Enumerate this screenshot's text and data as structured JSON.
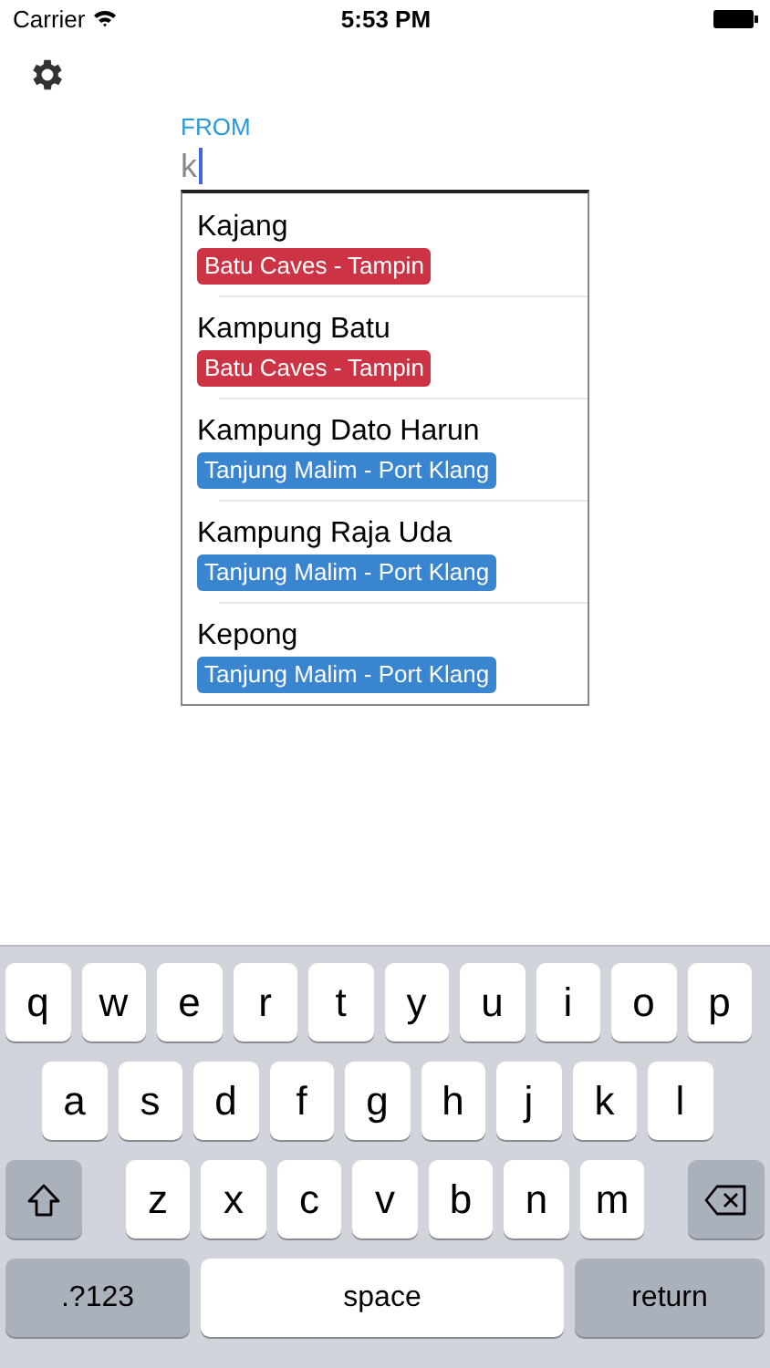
{
  "status_bar": {
    "carrier": "Carrier",
    "time": "5:53 PM"
  },
  "field": {
    "label": "FROM",
    "value": "k"
  },
  "suggestions": [
    {
      "name": "Kajang",
      "route": "Batu Caves - Tampin",
      "color": "#cc3344"
    },
    {
      "name": "Kampung Batu",
      "route": "Batu Caves - Tampin",
      "color": "#cc3344"
    },
    {
      "name": "Kampung Dato Harun",
      "route": "Tanjung Malim - Port Klang",
      "color": "#3a85d0"
    },
    {
      "name": "Kampung Raja Uda",
      "route": "Tanjung Malim - Port Klang",
      "color": "#3a85d0"
    },
    {
      "name": "Kepong",
      "route": "Tanjung Malim - Port Klang",
      "color": "#3a85d0"
    }
  ],
  "keyboard": {
    "rows": [
      [
        {
          "kind": "letter",
          "label": "q"
        },
        {
          "kind": "letter",
          "label": "w"
        },
        {
          "kind": "letter",
          "label": "e"
        },
        {
          "kind": "letter",
          "label": "r"
        },
        {
          "kind": "letter",
          "label": "t"
        },
        {
          "kind": "letter",
          "label": "y"
        },
        {
          "kind": "letter",
          "label": "u"
        },
        {
          "kind": "letter",
          "label": "i"
        },
        {
          "kind": "letter",
          "label": "o"
        },
        {
          "kind": "letter",
          "label": "p"
        }
      ],
      [
        {
          "kind": "letter",
          "label": "a"
        },
        {
          "kind": "letter",
          "label": "s"
        },
        {
          "kind": "letter",
          "label": "d"
        },
        {
          "kind": "letter",
          "label": "f"
        },
        {
          "kind": "letter",
          "label": "g"
        },
        {
          "kind": "letter",
          "label": "h"
        },
        {
          "kind": "letter",
          "label": "j"
        },
        {
          "kind": "letter",
          "label": "k"
        },
        {
          "kind": "letter",
          "label": "l"
        }
      ],
      [
        {
          "kind": "shift"
        },
        {
          "kind": "letter",
          "label": "z"
        },
        {
          "kind": "letter",
          "label": "x"
        },
        {
          "kind": "letter",
          "label": "c"
        },
        {
          "kind": "letter",
          "label": "v"
        },
        {
          "kind": "letter",
          "label": "b"
        },
        {
          "kind": "letter",
          "label": "n"
        },
        {
          "kind": "letter",
          "label": "m"
        },
        {
          "kind": "delete"
        }
      ]
    ],
    "bottom_row": {
      "numbers_key": ".?123",
      "space_key": "space",
      "return_key": "return"
    }
  }
}
